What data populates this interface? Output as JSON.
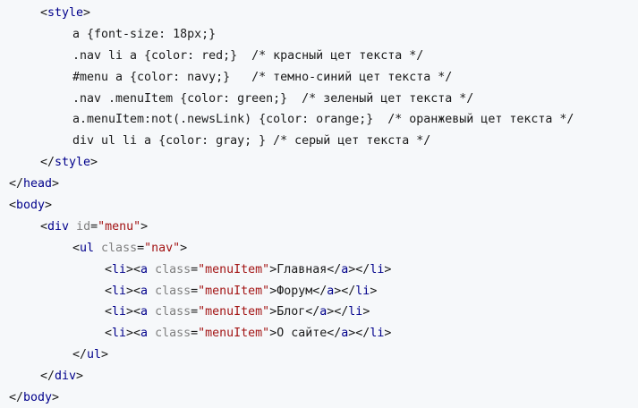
{
  "code_lines": [
    {
      "indent": 1,
      "type": "tag-open",
      "tag": "style"
    },
    {
      "indent": 2,
      "type": "text",
      "text": "a {font-size: 18px;}"
    },
    {
      "indent": 2,
      "type": "text",
      "text": ".nav li a {color: red;}  /* красный цет текста */"
    },
    {
      "indent": 2,
      "type": "text",
      "text": "#menu a {color: navy;}   /* темно-синий цет текста */"
    },
    {
      "indent": 2,
      "type": "text",
      "text": ".nav .menuItem {color: green;}  /* зеленый цет текста */"
    },
    {
      "indent": 2,
      "type": "text",
      "text": "a.menuItem:not(.newsLink) {color: orange;}  /* оранжевый цет текста */"
    },
    {
      "indent": 2,
      "type": "text",
      "text": "div ul li a {color: gray; } /* серый цет текста */"
    },
    {
      "indent": 1,
      "type": "tag-close",
      "tag": "style"
    },
    {
      "indent": 0,
      "type": "tag-close",
      "tag": "head"
    },
    {
      "indent": 0,
      "type": "tag-open",
      "tag": "body"
    },
    {
      "indent": 1,
      "type": "tag-attr",
      "tag": "div",
      "attr": "id",
      "value": "\"menu\""
    },
    {
      "indent": 2,
      "type": "tag-attr",
      "tag": "ul",
      "attr": "class",
      "value": "\"nav\""
    },
    {
      "indent": 3,
      "type": "li",
      "attr": "class",
      "value": "\"menuItem\"",
      "text": "Главная"
    },
    {
      "indent": 3,
      "type": "li",
      "attr": "class",
      "value": "\"menuItem\"",
      "text": "Форум"
    },
    {
      "indent": 3,
      "type": "li",
      "attr": "class",
      "value": "\"menuItem\"",
      "text": "Блог"
    },
    {
      "indent": 3,
      "type": "li",
      "attr": "class",
      "value": "\"menuItem\"",
      "text": "О сайте"
    },
    {
      "indent": 2,
      "type": "tag-close",
      "tag": "ul"
    },
    {
      "indent": 1,
      "type": "tag-close",
      "tag": "div"
    },
    {
      "indent": 0,
      "type": "tag-close",
      "tag": "body"
    }
  ],
  "colors": {
    "background": "#f6f8fa",
    "tag": "#00008b",
    "attr": "#7f7f7f",
    "value": "#a31515",
    "text": "#1a1a1a"
  }
}
